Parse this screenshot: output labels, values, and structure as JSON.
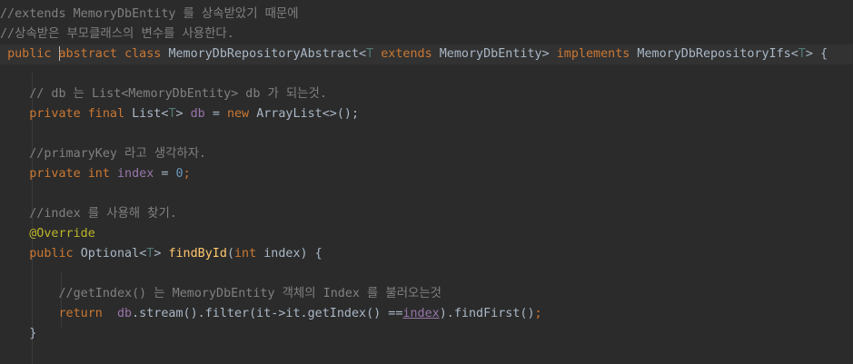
{
  "colors": {
    "background": "#2b2b2b",
    "current_line": "#323232",
    "comment": "#808080",
    "keyword": "#cc7832",
    "type_param": "#507874",
    "field": "#9876aa",
    "number": "#6897bb",
    "annotation": "#bbb529",
    "method": "#ffc66d",
    "plain": "#a9b7c6"
  },
  "code": {
    "l1": {
      "comment": "//extends MemoryDbEntity 를 상속받았기 때문에"
    },
    "l2": {
      "comment": "//상속받은 부모클래스의 변수를 사용한다."
    },
    "l3": {
      "public": "public",
      "abstract": "abstract",
      "class": "class",
      "name": "MemoryDbRepositoryAbstract",
      "lt1": "<",
      "T1": "T",
      "extends": "extends",
      "bound": "MemoryDbEntity",
      "gt1": ">",
      "implements": "implements",
      "iface": "MemoryDbRepositoryIfs",
      "lt2": "<",
      "T2": "T",
      "gt2": ">",
      "brace": "{"
    },
    "l5": {
      "comment": "// db 는 List<MemoryDbEntity> db 가 되는것."
    },
    "l6": {
      "private": "private",
      "final": "final",
      "list": "List",
      "lt": "<",
      "T": "T",
      "gt": ">",
      "field": "db",
      "eq": "=",
      "new": "new",
      "ctor": "ArrayList<>();"
    },
    "l8": {
      "comment": "//primaryKey 라고 생각하자."
    },
    "l9": {
      "private": "private",
      "int": "int",
      "field": "index",
      "eq": "=",
      "num": "0",
      "semi": ";"
    },
    "l11": {
      "comment": "//index 를 사용해 찾기."
    },
    "l12": {
      "annotation": "@Override"
    },
    "l13": {
      "public": "public",
      "optional": "Optional",
      "lt": "<",
      "T": "T",
      "gt": ">",
      "method": "findById",
      "paren_open": "(",
      "int": "int",
      "param": "index) {"
    },
    "l15": {
      "comment": "//getIndex() 는 MemoryDbEntity 객체의 Index 를 불러오는것"
    },
    "l16": {
      "return": "return",
      "field": "db",
      "chain": ".stream().filter(it->it.getIndex() ==",
      "index": "index",
      "tail": ").findFirst()",
      "semi": ";"
    },
    "l17": {
      "brace": "}"
    }
  }
}
